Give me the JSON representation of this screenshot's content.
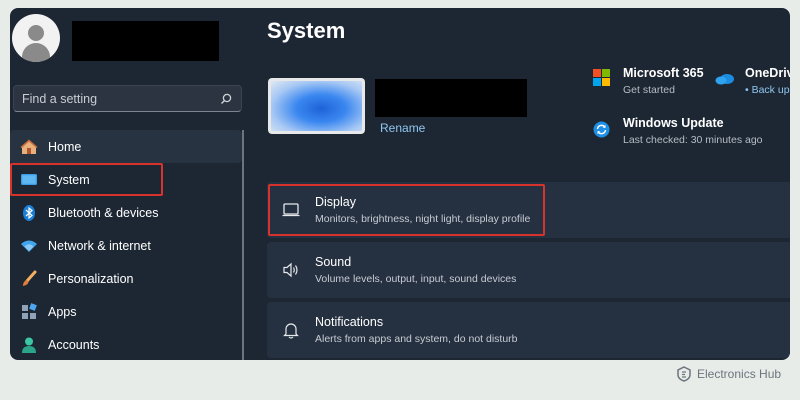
{
  "sidebar": {
    "search": {
      "placeholder": "Find a setting"
    },
    "items": [
      {
        "label": "Home",
        "icon": "home-icon"
      },
      {
        "label": "System",
        "icon": "system-icon"
      },
      {
        "label": "Bluetooth & devices",
        "icon": "bluetooth-icon"
      },
      {
        "label": "Network & internet",
        "icon": "wifi-icon"
      },
      {
        "label": "Personalization",
        "icon": "brush-icon"
      },
      {
        "label": "Apps",
        "icon": "apps-icon"
      },
      {
        "label": "Accounts",
        "icon": "accounts-icon"
      }
    ]
  },
  "main": {
    "title": "System",
    "rename_label": "Rename",
    "tiles": [
      {
        "title": "Microsoft 365",
        "subtitle": "Get started",
        "icon": "microsoft-365-icon"
      },
      {
        "title": "OneDriv",
        "subtitle": "• Back up",
        "icon": "onedrive-icon"
      },
      {
        "title": "Windows Update",
        "subtitle": "Last checked: 30 minutes ago",
        "icon": "windows-update-icon"
      }
    ],
    "cards": [
      {
        "title": "Display",
        "subtitle": "Monitors, brightness, night light, display profile",
        "icon": "display-icon"
      },
      {
        "title": "Sound",
        "subtitle": "Volume levels, output, input, sound devices",
        "icon": "speaker-icon"
      },
      {
        "title": "Notifications",
        "subtitle": "Alerts from apps and system, do not disturb",
        "icon": "bell-icon"
      }
    ]
  },
  "watermark": {
    "text": "Electronics Hub"
  },
  "colors": {
    "highlight": "#d8322c",
    "accent": "#8fc6f0",
    "background": "#1d2733"
  }
}
